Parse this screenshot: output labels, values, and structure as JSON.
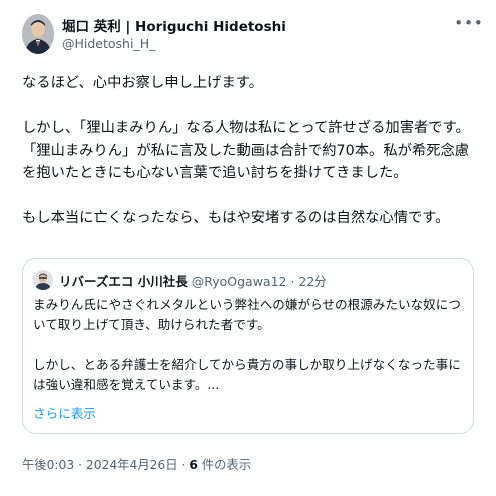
{
  "author": {
    "display_name": "堀口 英利 | Horiguchi Hidetoshi",
    "handle": "@Hidetoshi_H_"
  },
  "more_icon": "more-horizontal-icon",
  "post_text": "なるほど、心中お察し申し上げます。\n\nしかし、「狸山まみりん」なる人物は私にとって許せざる加害者です。「狸山まみりん」が私に言及した動画は合計で約70本。私が希死念慮を抱いたときにも心ない言葉で追い討ちを掛けてきました。\n\nもし本当に亡くなったなら、もはや安堵するのは自然な心情です。",
  "quote": {
    "author_name": "リバーズエコ 小川社長",
    "handle_time": "@RyoOgawa12 · 22分",
    "text": "まみりん氏にやさぐれメタルという弊社への嫌がらせの根源みたいな奴について取り上げて頂き、助けられた者です。\n\nしかし、とある弁護士を紹介してから貴方の事しか取り上げなくなった事には強い違和感を覚えています。...",
    "show_more": "さらに表示"
  },
  "meta": {
    "timestamp": "午後0:03 · 2024年4月26日 · ",
    "views_count": "6",
    "views_label": " 件の表示"
  }
}
